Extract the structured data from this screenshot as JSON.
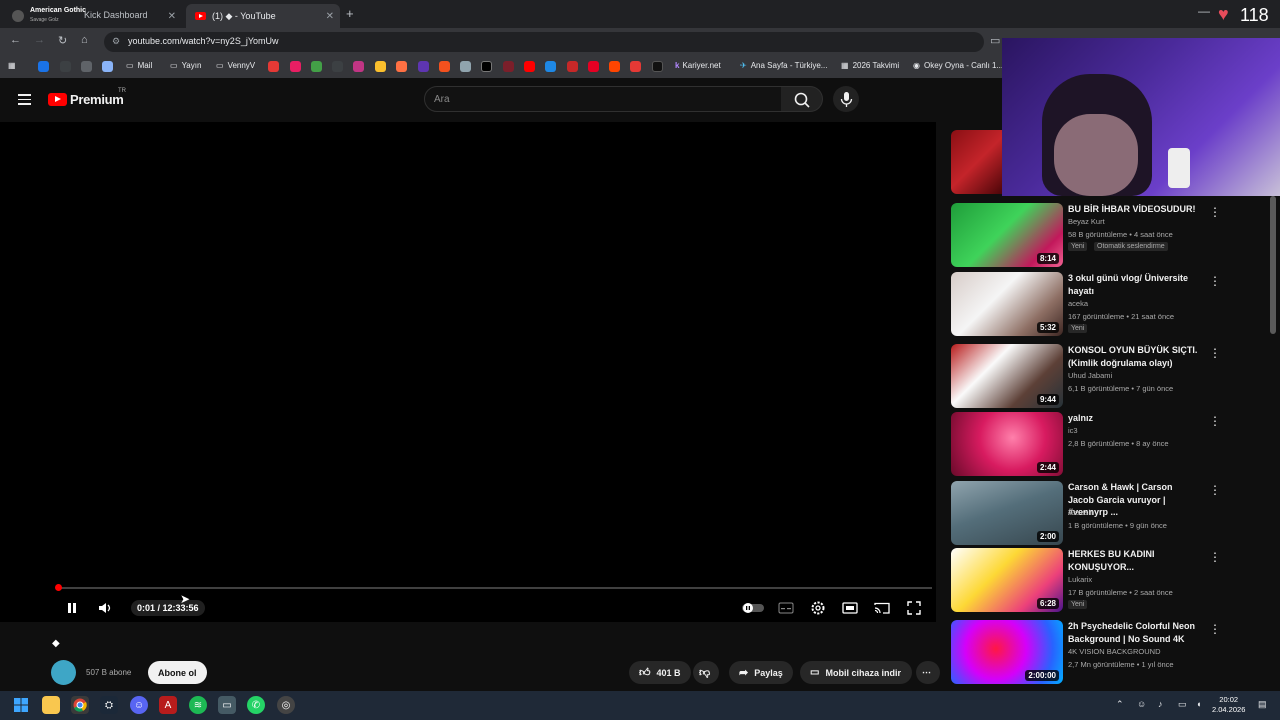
{
  "browser": {
    "tabs": [
      {
        "label": "Kick Dashboard",
        "overlay_title": "American Gothic",
        "overlay_sub": "Savage Golz"
      },
      {
        "label": "(1) ◆ - YouTube"
      }
    ],
    "url": "youtube.com/watch?v=ny2S_jYomUw",
    "heart_count": "118",
    "bookmarks": [
      "Mail",
      "Yayın",
      "VennyV",
      "Kariyer.net",
      "Ana Sayfa - Türkiye...",
      "2026 Takvimi",
      "Okey Oyna - Canlı 1..."
    ]
  },
  "youtube": {
    "logo_text": "Premium",
    "logo_country": "TR",
    "search_placeholder": "Ara",
    "player": {
      "time": "0:01 / 12:33:56",
      "progress_fraction": 0.0014
    },
    "channel": {
      "subscribers": "507 B abone",
      "subscribe_label": "Abone ol"
    },
    "actions": {
      "likes": "401 B",
      "share": "Paylaş",
      "download": "Mobil cihaza indir"
    },
    "recommendations": [
      {
        "title": "BU BİR İHBAR VİDEOSUDUR!",
        "channel": "Beyaz Kurt",
        "stats": "58 B görüntüleme • 4 saat önce",
        "badges": [
          "Yeni",
          "Otomatik seslendirme"
        ],
        "duration": "8:14",
        "thumb": "green"
      },
      {
        "title": "3 okul günü vlog/ Üniversite hayatı",
        "channel": "aceka",
        "stats": "167 görüntüleme • 21 saat önce",
        "badges": [
          "Yeni"
        ],
        "duration": "5:32",
        "thumb": "classroom"
      },
      {
        "title": "KONSOL OYUN BÜYÜK SIÇTI. (Kimlik doğrulama olayı)",
        "channel": "Uhud Jabami",
        "stats": "6,1 B görüntüleme • 7 gün önce",
        "badges": [],
        "duration": "9:44",
        "thumb": "beard"
      },
      {
        "title": "yalnız",
        "channel": "ic3",
        "stats": "2,8 B görüntüleme • 8 ay önce",
        "badges": [],
        "duration": "2:44",
        "thumb": "pink"
      },
      {
        "title": "Carson & Hawk | Carson Jacob Garcia vuruyor | #vennyrp ...",
        "channel": "Assasin",
        "stats": "1 B görüntüleme • 9 gün önce",
        "badges": [],
        "duration": "2:00",
        "thumb": "game"
      },
      {
        "title": "HERKES BU KADINI KONUŞUYOR...",
        "channel": "Lukarix",
        "stats": "17 B görüntüleme • 2 saat önce",
        "badges": [
          "Yeni"
        ],
        "duration": "6:28",
        "thumb": "woman"
      },
      {
        "title": "2h Psychedelic Colorful Neon Background | No Sound 4K",
        "channel": "4K VISION BACKGROUND",
        "stats": "2,7 Mn görüntüleme • 1 yıl önce",
        "badges": [],
        "duration": "2:00:00",
        "thumb": "neon"
      }
    ]
  },
  "taskbar": {
    "time": "20:02",
    "date": "2.04.2026"
  }
}
